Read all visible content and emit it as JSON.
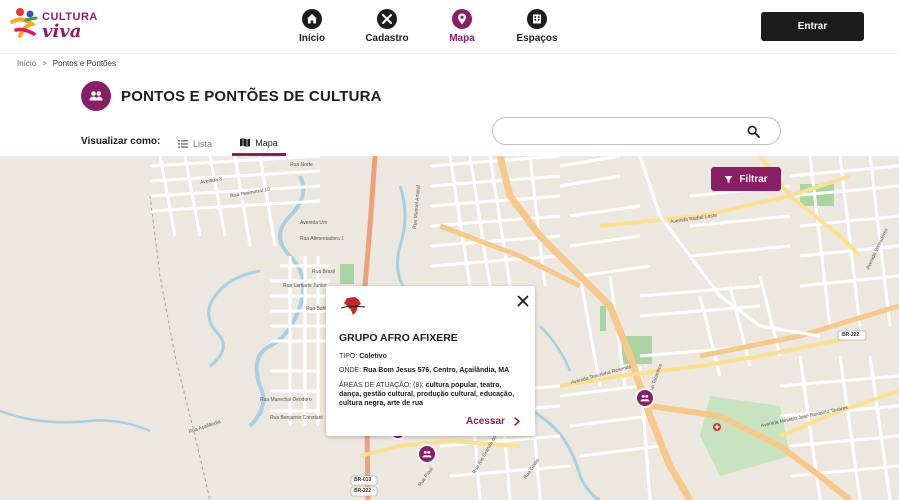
{
  "header": {
    "logo_line1": "CULTURA",
    "logo_line2": "viva",
    "nav": [
      {
        "label": "Início",
        "icon": "home-icon"
      },
      {
        "label": "Cadastro",
        "icon": "tools-icon"
      },
      {
        "label": "Mapa",
        "icon": "map-pin-icon"
      },
      {
        "label": "Espaços",
        "icon": "building-icon"
      }
    ],
    "active_nav": "Mapa",
    "login_label": "Entrar"
  },
  "breadcrumb": {
    "home": "Início",
    "separator": ">",
    "current": "Pontos e Pontões"
  },
  "page": {
    "title": "PONTOS E PONTÕES DE CULTURA",
    "icon": "people-icon"
  },
  "view": {
    "label": "Visualizar como:",
    "tabs": [
      {
        "label": "Lista",
        "icon": "list-icon"
      },
      {
        "label": "Mapa",
        "icon": "map-icon"
      }
    ],
    "active": "Mapa"
  },
  "search": {
    "value": "",
    "placeholder": "",
    "icon": "search-icon"
  },
  "filter": {
    "label": "Filtrar",
    "icon": "filter-icon"
  },
  "map_labels": {
    "roads": [
      "Avenida 3",
      "Rua Norte",
      "Rua Perimetral 10",
      "Rua Alimentadora 1",
      "Avenida Um",
      "Rua Brasil",
      "Rua Lamarie Junior",
      "Rua Bahia",
      "Rua Marechal Deodoro",
      "Rua Benjamin Constant",
      "Rua Manuel Amaral",
      "Avenida Terezinha Resende",
      "Rua Tocantins",
      "Rua Rio Grande do Norte",
      "Rua Goiás",
      "Rua Piauí",
      "Avenida Ministro José Reinaldo Tavares",
      "Avenida Vereadores",
      "Avenida Radial Leste",
      "Rua Açailândia"
    ],
    "highways": [
      "BR-222",
      "BR-010"
    ]
  },
  "popup": {
    "title": "GRUPO AFRO AFIXERE",
    "type_label": "TIPO:",
    "type_value": "Coletivo",
    "address_label": "ONDE:",
    "address_value": "Rua Bom Jesus 576, Centro, Açailândia, MA",
    "areas_label": "ÁREAS DE ATUAÇÃO: (8):",
    "areas_value": "cultura popular, teatro, dança, gestão cultural, produção cultural, educação, cultura negra, arte de rua",
    "link_label": "Acessar",
    "close_icon": "close-icon",
    "logo_icon": "africa-logo-icon"
  },
  "colors": {
    "brand": "#8a1e66",
    "dark": "#1c1c1c",
    "map_bg": "#ece8e0",
    "road_major": "#f6c98b",
    "water": "#a9cfe3",
    "park": "#a8d5a2"
  }
}
